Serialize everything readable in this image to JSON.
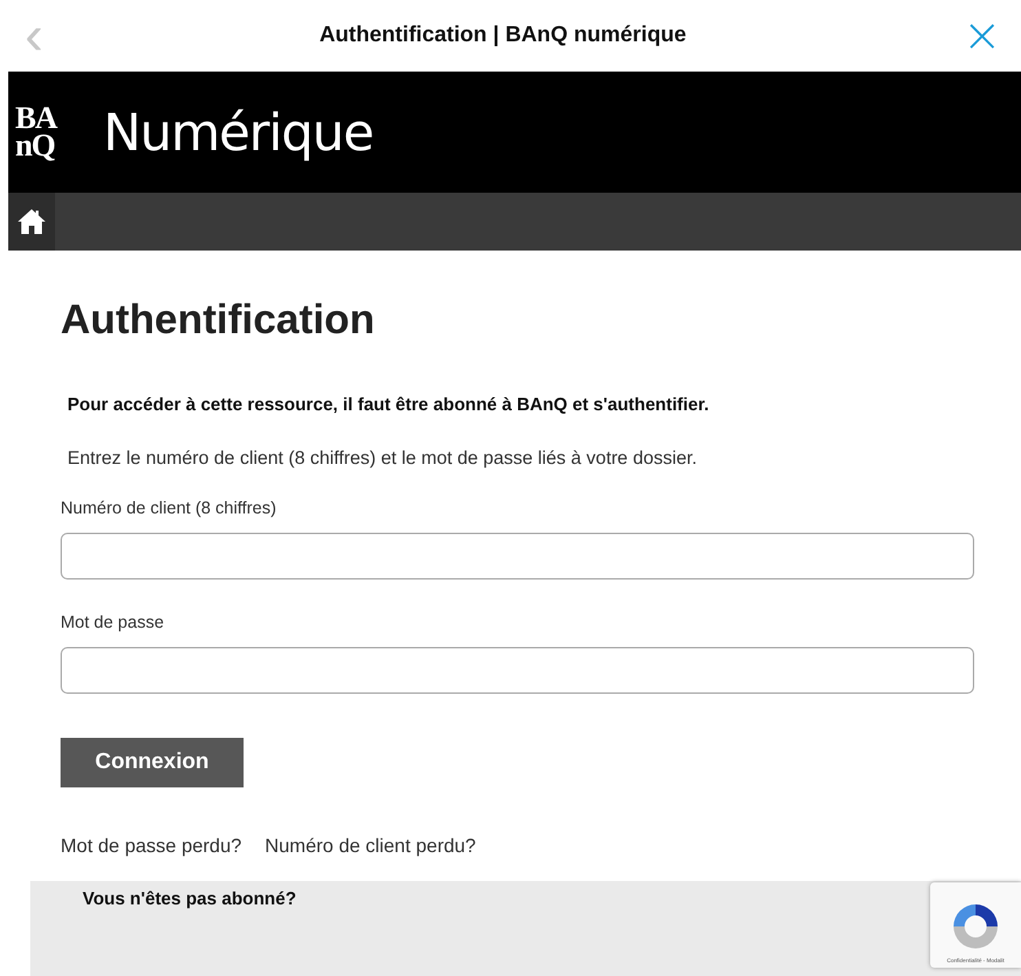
{
  "window": {
    "title": "Authentification | BAnQ numérique",
    "back": "‹",
    "close": "×"
  },
  "header": {
    "logo_lines": [
      "BA",
      "nQ"
    ],
    "title": "Numérique"
  },
  "heading": "Authentification",
  "notice": "Pour accéder à cette ressource, il faut être abonné à BAnQ et s'authentifier.",
  "instructions": "Entrez le numéro de client (8 chiffres) et le mot de passe liés à votre dossier.",
  "fields": [
    {
      "label": "Numéro de client (8 chiffres)"
    },
    {
      "label": "Mot de passe"
    }
  ],
  "submit": "Connexion",
  "links": [
    "Mot de passe perdu?",
    "Numéro de client perdu?"
  ],
  "signup": {
    "title": "Vous n'êtes pas abonné?"
  },
  "recaptcha": {
    "text": "Confidentialité - Modalit"
  }
}
